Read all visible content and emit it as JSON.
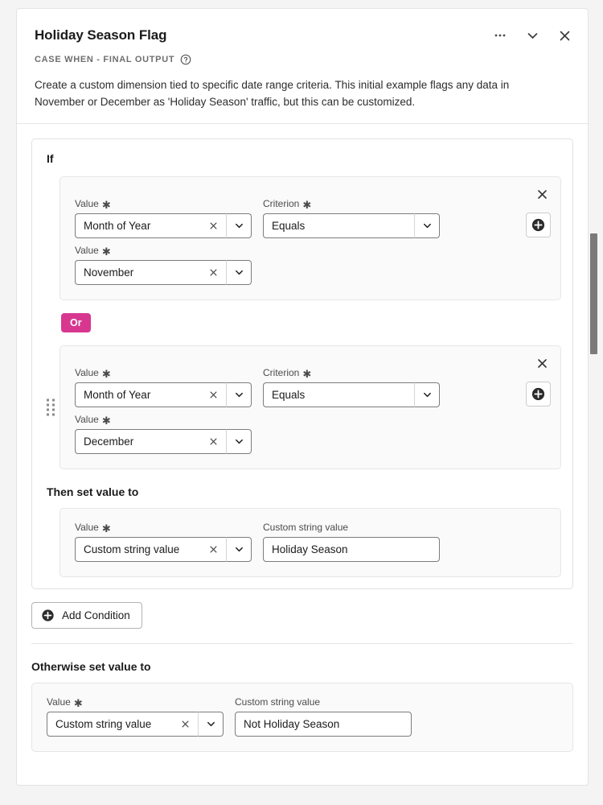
{
  "header": {
    "title": "Holiday Season Flag",
    "subtitle": "CASE WHEN - FINAL OUTPUT",
    "description": "Create a custom dimension tied to specific date range criteria. This initial example flags any data in November or December as 'Holiday Season' traffic, but this can be customized.",
    "more_icon": "ellipsis-icon",
    "collapse_icon": "chevron-down-icon",
    "close_icon": "close-icon",
    "help_icon": "help-circle-icon"
  },
  "if_group": {
    "label": "If",
    "conditions": [
      {
        "value_label": "Value",
        "value": "Month of Year",
        "criterion_label": "Criterion",
        "criterion": "Equals",
        "value2_label": "Value",
        "value2": "November",
        "has_grip": false
      },
      {
        "value_label": "Value",
        "value": "Month of Year",
        "criterion_label": "Criterion",
        "criterion": "Equals",
        "value2_label": "Value",
        "value2": "December",
        "has_grip": true
      }
    ],
    "operator_badge": "Or",
    "then_label": "Then set value to",
    "then": {
      "value_label": "Value",
      "value": "Custom string value",
      "custom_label": "Custom string value",
      "custom_value": "Holiday Season"
    }
  },
  "add_condition": {
    "label": "Add Condition",
    "icon": "plus-circle-icon"
  },
  "otherwise": {
    "label": "Otherwise set value to",
    "value_label": "Value",
    "value": "Custom string value",
    "custom_label": "Custom string value",
    "custom_value": "Not Holiday Season"
  },
  "required_marker": "✱",
  "colors": {
    "accent_or_badge": "#d83790",
    "page_background": "#f4f4f4",
    "panel_background": "#ffffff",
    "card_background": "#fafafa"
  }
}
